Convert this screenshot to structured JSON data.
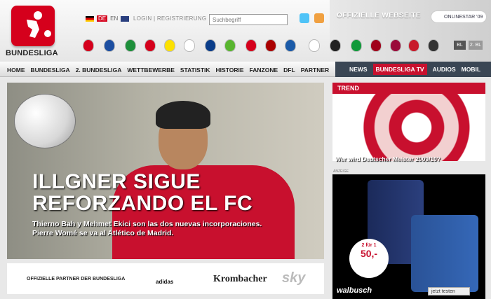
{
  "brand": {
    "logo_text": "BUNDESLIGA",
    "red": "#d5001c",
    "dark": "#3a4654"
  },
  "header": {
    "lang_de": "DE",
    "lang_en": "EN",
    "login": "LOGIN",
    "separator": "|",
    "register": "REGISTRIERUNG",
    "search_placeholder": "Suchbegriff",
    "official": "OFFIZIELLE WEBSEITE",
    "online_star": "ONLINESTAR '09",
    "bl1": "BL",
    "bl2": "2. BL",
    "club_icons": [
      "bayern-icon",
      "schalke-icon",
      "werder-icon",
      "leverkusen-icon",
      "dortmund-icon",
      "stuttgart-icon",
      "hamburg-icon",
      "wolfsburg-icon",
      "mainz-icon",
      "frankfurt-icon",
      "hoffenheim-icon",
      "koeln-icon",
      "freiburg-icon",
      "hannover-icon",
      "nuernberg-icon",
      "bochum-icon"
    ]
  },
  "nav": {
    "left": [
      "HOME",
      "BUNDESLIGA",
      "2. BUNDESLIGA",
      "WETTBEWERBE",
      "STATISTIK",
      "HISTORIE",
      "FANZONE",
      "DFL",
      "PARTNER"
    ],
    "right": [
      "NEWS",
      "BUNDESLIGA TV",
      "AUDIOS",
      "MOBIL"
    ]
  },
  "hero": {
    "headline_1": "ILLGNER SIGUE",
    "headline_2": "REFORZANDO EL FC",
    "sub_1": "Thierno Bah y Mehmet Ekici son las dos nuevas incorporaciones.",
    "sub_2": "Pierre Womé se va al Atlético de Madrid."
  },
  "partners": {
    "title": "OFFIZIELLE PARTNER DER BUNDESLIGA",
    "logos": [
      "adidas",
      "Krombacher",
      "sky"
    ]
  },
  "sidebar": {
    "trend_title": "TREND",
    "trend_caption": "Wer wird Deutscher Meister 2009/10?",
    "ad_label": "ANZEIGE",
    "ad_badge_1": "2 für 1",
    "ad_badge_price": "50,-",
    "ad_brand": "walbusch",
    "ad_cta": "jetzt testen"
  }
}
